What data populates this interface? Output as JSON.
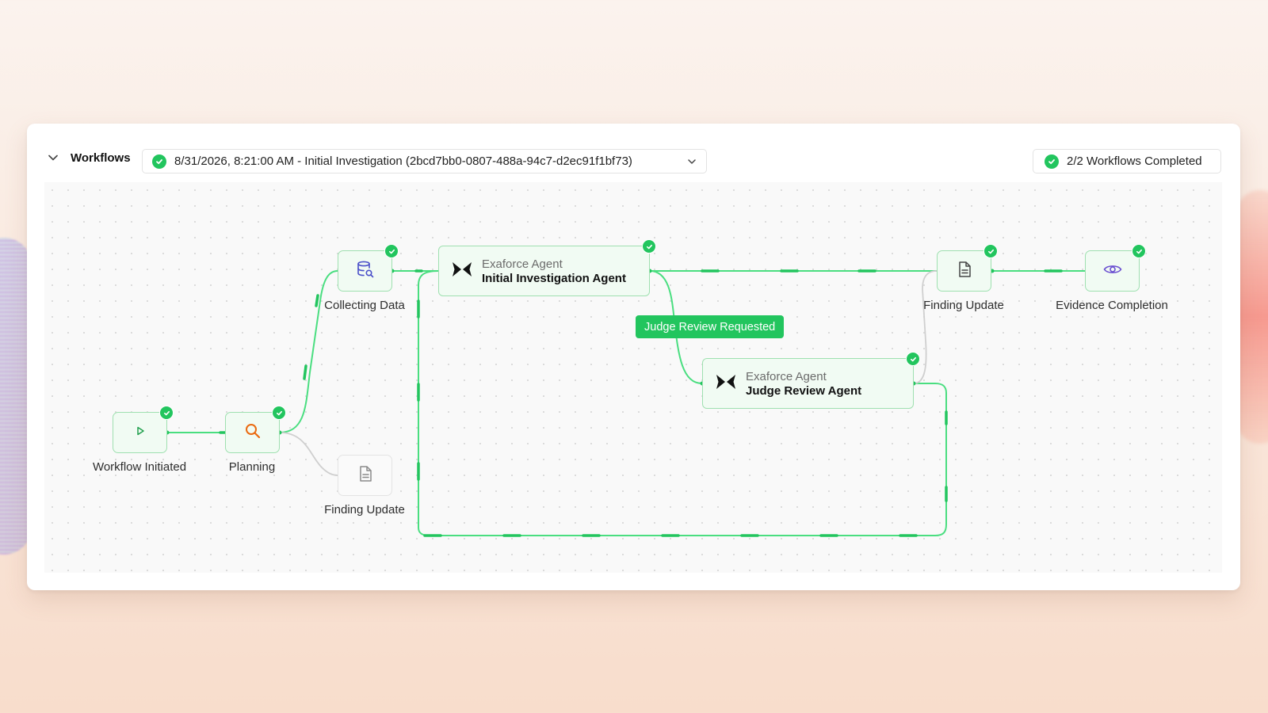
{
  "header": {
    "title": "Workflows",
    "selected_workflow": "8/31/2026, 8:21:00 AM - Initial Investigation (2bcd7bb0-0807-488a-94c7-d2ec91f1bf73)",
    "completed_badge": "2/2 Workflows Completed"
  },
  "nodes": {
    "workflow_initiated": "Workflow Initiated",
    "planning": "Planning",
    "collecting_data": "Collecting Data",
    "finding_update_pending": "Finding Update",
    "finding_update": "Finding Update",
    "evidence_completion": "Evidence Completion"
  },
  "agents": {
    "initial": {
      "provider": "Exaforce Agent",
      "name": "Initial Investigation Agent"
    },
    "judge": {
      "provider": "Exaforce Agent",
      "name": "Judge Review Agent"
    }
  },
  "edge_label": "Judge Review Requested",
  "colors": {
    "accent": "#22c55e",
    "node_border": "#9fe0b0",
    "node_bg": "#f1fbf3"
  },
  "icons": {
    "play": "play-icon",
    "search": "search-icon",
    "database": "database-search-icon",
    "document": "document-icon",
    "eye": "eye-icon",
    "agent": "exaforce-logo-icon",
    "check": "check-icon",
    "chevron": "chevron-down-icon"
  }
}
